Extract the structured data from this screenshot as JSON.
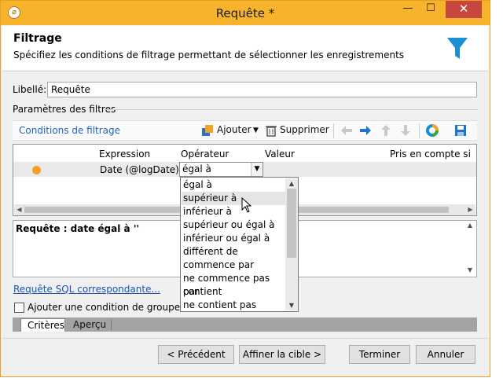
{
  "window": {
    "title": "Requête *",
    "min_glyph": "—",
    "max_glyph": "☐",
    "close_glyph": "✕"
  },
  "header": {
    "title": "Filtrage",
    "description": "Spécifiez les conditions de filtrage permettant de sélectionner les enregistrements"
  },
  "form": {
    "libelle_label": "Libellé:",
    "libelle_value": "Requête",
    "params_label": "Paramètres des filtres"
  },
  "toolbar": {
    "title": "Conditions de filtrage",
    "add_label": "Ajouter",
    "delete_label": "Supprimer"
  },
  "grid": {
    "columns": [
      "Expression",
      "Opérateur",
      "Valeur",
      "Pris en compte si"
    ],
    "row": {
      "expression": "Date (@logDate)",
      "operator": "égal à"
    }
  },
  "query_text": "Requête : date égal à ''",
  "sql_link": "Requête SQL correspondante...",
  "group_checkbox_label": "Ajouter une condition de groupement",
  "tabs": [
    "Critères",
    "Aperçu"
  ],
  "buttons": {
    "previous": "< Précédent",
    "refine": "Affiner la cible >",
    "finish": "Terminer",
    "cancel": "Annuler"
  },
  "operator_dropdown": {
    "hovered_index": 1,
    "options": [
      "égal à",
      "supérieur à",
      "inférieur à",
      "supérieur ou égal à",
      "inférieur ou égal à",
      "différent de",
      "commence par",
      "ne commence pas par",
      "contient",
      "ne contient pas"
    ]
  },
  "colors": {
    "titlebar": "#f7b32b",
    "close": "#c7463d",
    "link": "#1f65b7",
    "accent_icon": "#1a8fd1",
    "status_dot": "#f1a227"
  }
}
